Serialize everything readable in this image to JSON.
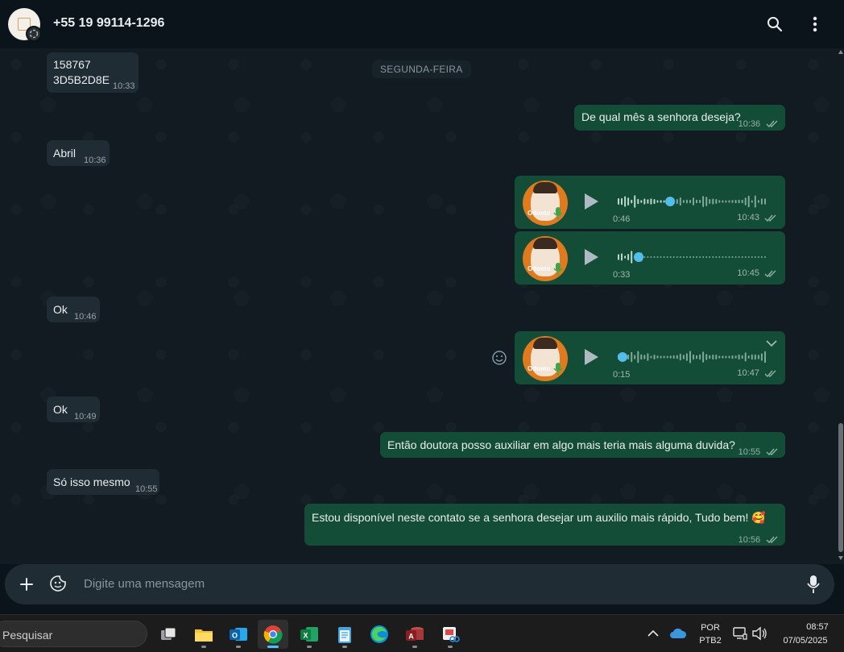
{
  "header": {
    "contact_name": "+55 19 99114-1296"
  },
  "chat": {
    "date_chip": "SEGUNDA-FEIRA",
    "messages": [
      {
        "text": "158767\n3D5B2D8E",
        "time": "10:33",
        "dir": "in"
      },
      {
        "text": "De qual mês a senhora deseja?",
        "time": "10:36",
        "dir": "out"
      },
      {
        "text": "Abril",
        "time": "10:36",
        "dir": "in"
      },
      {
        "text": "Ok",
        "time": "10:46",
        "dir": "in"
      },
      {
        "text": "Ok",
        "time": "10:49",
        "dir": "in"
      },
      {
        "text": "Então doutora posso auxiliar em algo mais teria mais alguma duvida?",
        "time": "10:55",
        "dir": "out"
      },
      {
        "text": "Só isso mesmo",
        "time": "10:55",
        "dir": "in"
      },
      {
        "text": "Estou disponível neste contato se a senhora desejar um auxilio mais rápido, Tudo bem! 🥰",
        "time": "10:56",
        "dir": "out"
      }
    ],
    "voice_notes": [
      {
        "duration": "0:46",
        "time": "10:43",
        "progress": 0.35,
        "avatar_label": "Odonto"
      },
      {
        "duration": "0:33",
        "time": "10:45",
        "progress": 0.14,
        "avatar_label": "Odonto"
      },
      {
        "duration": "0:15",
        "time": "10:47",
        "progress": 0.0,
        "avatar_label": "Odonto"
      }
    ]
  },
  "composer": {
    "placeholder": "Digite uma mensagem"
  },
  "taskbar": {
    "search_label": "Pesquisar",
    "lang_top": "POR",
    "lang_bottom": "PTB2",
    "clock_time": "08:57",
    "clock_date": "07/05/2025"
  },
  "colors": {
    "incoming_bubble": "#202c33",
    "outgoing_bubble": "#144d37",
    "read_ticks": "#8fb3a3",
    "voice_progress": "#53bdeb"
  }
}
